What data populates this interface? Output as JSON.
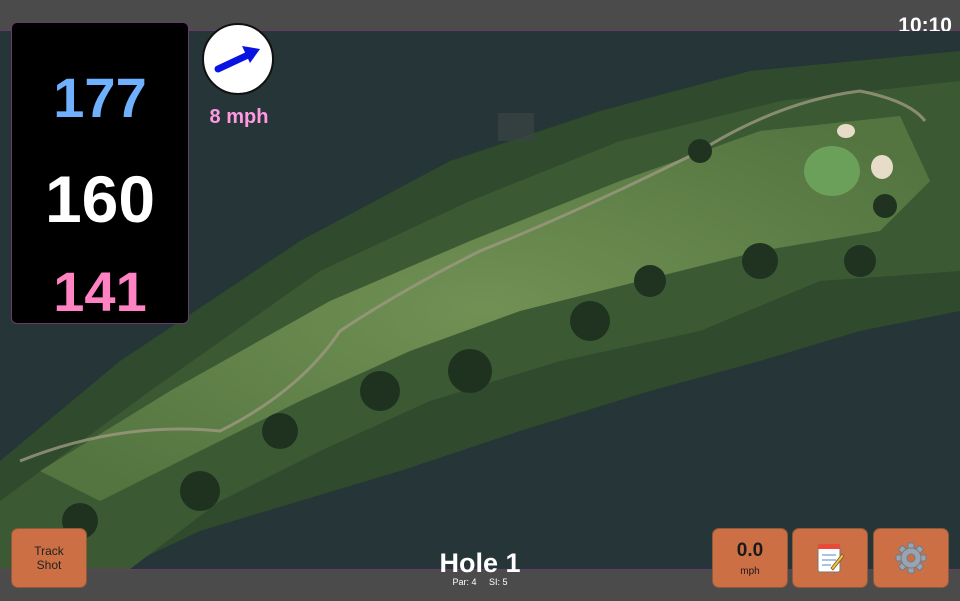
{
  "status": {
    "time": "10:10"
  },
  "distances": {
    "back": "177",
    "middle": "160",
    "front": "141"
  },
  "wind": {
    "speed": "8 mph",
    "direction_icon": "arrow-icon"
  },
  "hole": {
    "title": "Hole 1",
    "par": "Par: 4",
    "stroke_index": "SI: 5"
  },
  "buttons": {
    "track_shot": "Track\nShot",
    "speed_value": "0.0",
    "speed_unit": "mph",
    "notes_icon": "notepad-icon",
    "settings_icon": "gear-icon"
  },
  "colors": {
    "back_distance": "#6fb0ff",
    "middle_distance": "#ffffff",
    "front_distance": "#ff83c2",
    "wind_text": "#ff9ae0",
    "button": "#cc6f45",
    "accent_border": "#6a3a6a"
  }
}
